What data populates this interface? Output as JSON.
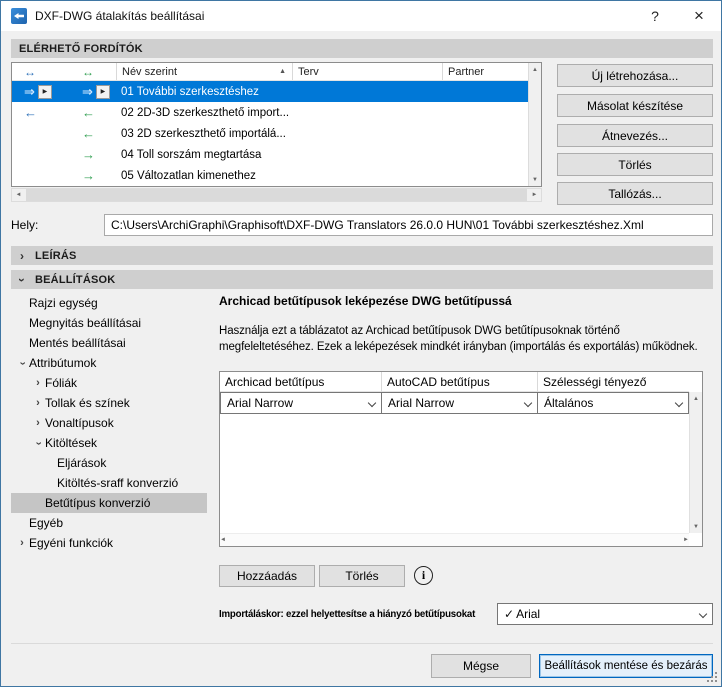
{
  "window": {
    "title": "DXF-DWG átalakítás beállításai",
    "help": "?",
    "close": "×"
  },
  "icons": {
    "chevron": "›",
    "sort_ascending": "▲",
    "scroll_up": "▲",
    "scroll_down": "▼",
    "scroll_left": "◄",
    "scroll_right": "►",
    "flyout": "▶",
    "info": "i",
    "check": "✓"
  },
  "translators": {
    "section_header": "ELÉRHETŐ FORDÍTÓK",
    "columns": {
      "dir_save": "↔",
      "dir_open": "↔",
      "name": "Név szerint",
      "plan": "Terv",
      "partner": "Partner"
    },
    "rows": [
      {
        "name": "01 További szerkesztéshez",
        "save_arrow": "⇒",
        "open_arrow": "⇒"
      },
      {
        "name": "02 2D-3D szerkeszthető import...",
        "save_arrow": "←",
        "open_arrow": "←"
      },
      {
        "name": "03 2D szerkeszthető importálá...",
        "open_arrow": "←"
      },
      {
        "name": "04 Toll sorszám megtartása",
        "open_arrow": "→"
      },
      {
        "name": "05 Változatlan kimenethez",
        "open_arrow": "→"
      }
    ],
    "buttons": {
      "new": "Új létrehozása...",
      "duplicate": "Másolat készítése",
      "rename": "Átnevezés...",
      "delete": "Törlés",
      "browse": "Tallózás..."
    }
  },
  "location": {
    "label": "Hely:",
    "path": "C:\\Users\\ArchiGraphi\\Graphisoft\\DXF-DWG Translators 26.0.0 HUN\\01 További szerkesztéshez.Xml"
  },
  "sections": {
    "description": "LEÍRÁS",
    "settings": "BEÁLLÍTÁSOK"
  },
  "tree": {
    "items": [
      {
        "label": "Rajzi egység"
      },
      {
        "label": "Megnyitás beállításai"
      },
      {
        "label": "Mentés beállításai"
      },
      {
        "label": "Attribútumok"
      },
      {
        "label": "Fóliák"
      },
      {
        "label": "Tollak és színek"
      },
      {
        "label": "Vonaltípusok"
      },
      {
        "label": "Kitöltések"
      },
      {
        "label": "Eljárások"
      },
      {
        "label": "Kitöltés-sraff konverzió"
      },
      {
        "label": "Betűtípus konverzió"
      },
      {
        "label": "Egyéb"
      },
      {
        "label": "Egyéni funkciók"
      }
    ]
  },
  "font_mapping": {
    "title": "Archicad betűtípusok leképezése DWG betűtípussá",
    "description": "Használja ezt a táblázatot az Archicad betűtípusok DWG betűtípusoknak történő megfeleltetéséhez. Ezek a leképezések mindkét irányban (importálás és exportálás) működnek.",
    "columns": [
      "Archicad betűtípus",
      "AutoCAD betűtípus",
      "Szélességi tényező"
    ],
    "mapping_row": {
      "archicad": "Arial Narrow",
      "autocad": "Arial Narrow",
      "width_factor": "Általános"
    },
    "add": "Hozzáadás",
    "delete": "Törlés",
    "import_label": "Importáláskor: ezzel helyettesítse a hiányzó betűtípusokat",
    "import_font": "Arial"
  },
  "footer": {
    "cancel": "Mégse",
    "save_close": "Beállítások mentése és bezárás"
  }
}
